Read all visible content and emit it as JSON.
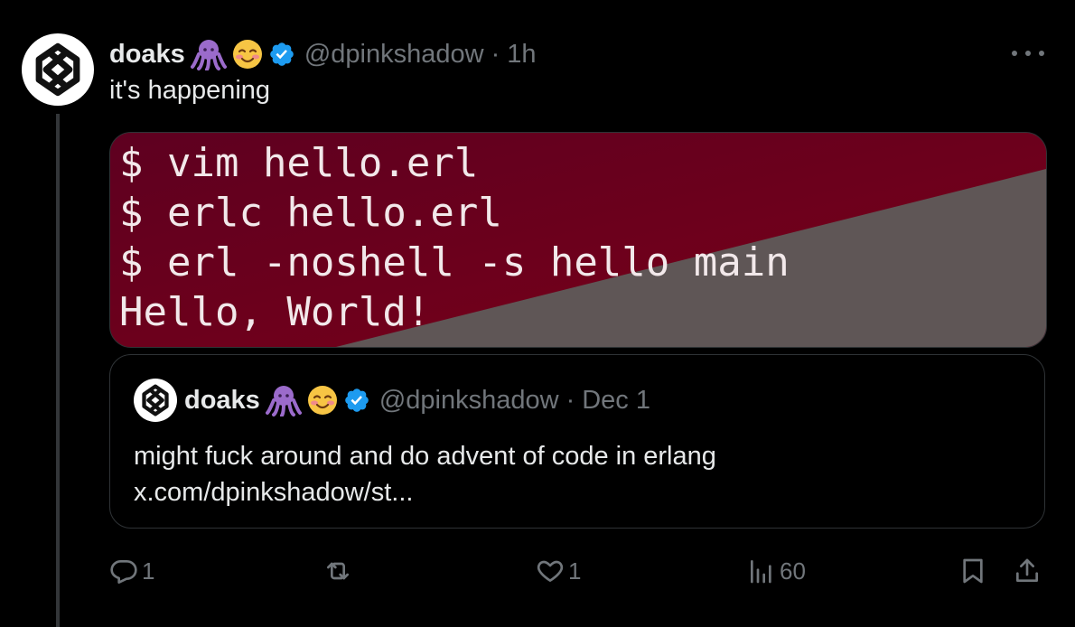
{
  "tweet": {
    "author_name": "doaks",
    "author_handle": "@dpinkshadow",
    "separator": "·",
    "time": "1h",
    "text": "it's happening",
    "emojis": [
      "octopus-emoji",
      "smiling-face-emoji"
    ],
    "verified_color": "#1d9bf0",
    "media": {
      "terminal_lines": [
        "$ vim hello.erl",
        "$ erlc hello.erl",
        "$ erl -noshell -s hello main",
        "Hello, World!"
      ],
      "bg_color": "#6b0020",
      "overlay_color": "#5f5656"
    }
  },
  "quoted_tweet": {
    "author_name": "doaks",
    "author_handle": "@dpinkshadow",
    "separator": "·",
    "date": "Dec 1",
    "text_line1": "might fuck around and do advent of code in erlang",
    "text_line2": "x.com/dpinkshadow/st..."
  },
  "actions": {
    "reply_count": "1",
    "like_count": "1",
    "views_count": "60"
  },
  "colors": {
    "background": "#000000",
    "text": "#e7e9ea",
    "muted": "#71767b",
    "border": "#2f3336"
  }
}
